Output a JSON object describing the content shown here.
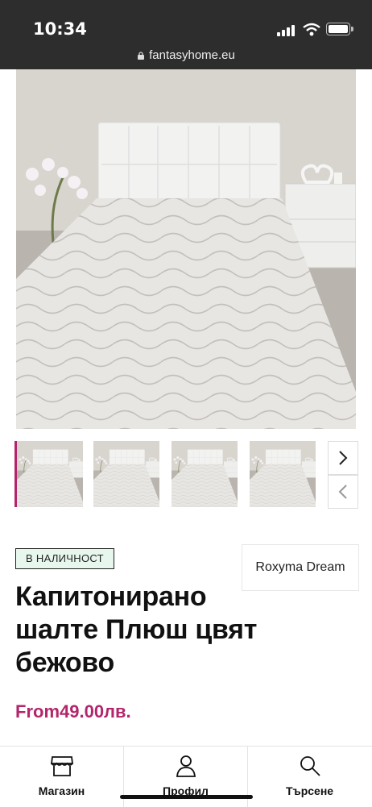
{
  "status_bar": {
    "time": "10:34"
  },
  "browser": {
    "url": "fantasyhome.eu"
  },
  "product": {
    "stock_badge": "В НАЛИЧНОСТ",
    "brand": "Roxyma Dream",
    "title": "Капитонирано шалте Плюш цвят бежово",
    "price": "From49.00лв."
  },
  "gallery": {
    "thumbnail_count": 4
  },
  "bottom_nav": {
    "items": [
      {
        "label": "Магазин",
        "icon": "store-icon"
      },
      {
        "label": "Профил",
        "icon": "user-icon"
      },
      {
        "label": "Търсене",
        "icon": "search-icon"
      }
    ]
  },
  "colors": {
    "accent": "#b3266b",
    "badge_bg": "#e7f7ee",
    "topbar": "#2d2d2d"
  }
}
